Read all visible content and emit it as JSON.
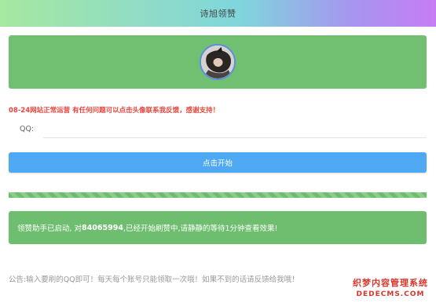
{
  "header": {
    "title": "诗旭领赞"
  },
  "banner": {
    "avatar_icon": "avatar-icon"
  },
  "notice": "08-24网站正常运营 有任何问题可以点击头像联系我反馈，感谢支持！",
  "form": {
    "qq_label": "QQ:",
    "qq_value": ""
  },
  "actions": {
    "start_label": "点击开始"
  },
  "progress": {
    "percent": 100
  },
  "status": {
    "prefix": "领赞助手已启动, 对",
    "qq": "84065994",
    "suffix": ",已经开始刷赞中,请静静的等待1分钟查看效果!"
  },
  "announcement": "公告:输入要刷的QQ即可！每天每个账号只能领取一次哦！如果不到的话请反馈给我哦！",
  "watermark": {
    "line1": "织梦内容管理系统",
    "line2": "DEDECMS.COM"
  },
  "colors": {
    "accent_green": "#71bf71",
    "button_blue": "#4fa8f2",
    "notice_red": "#e8453c"
  }
}
